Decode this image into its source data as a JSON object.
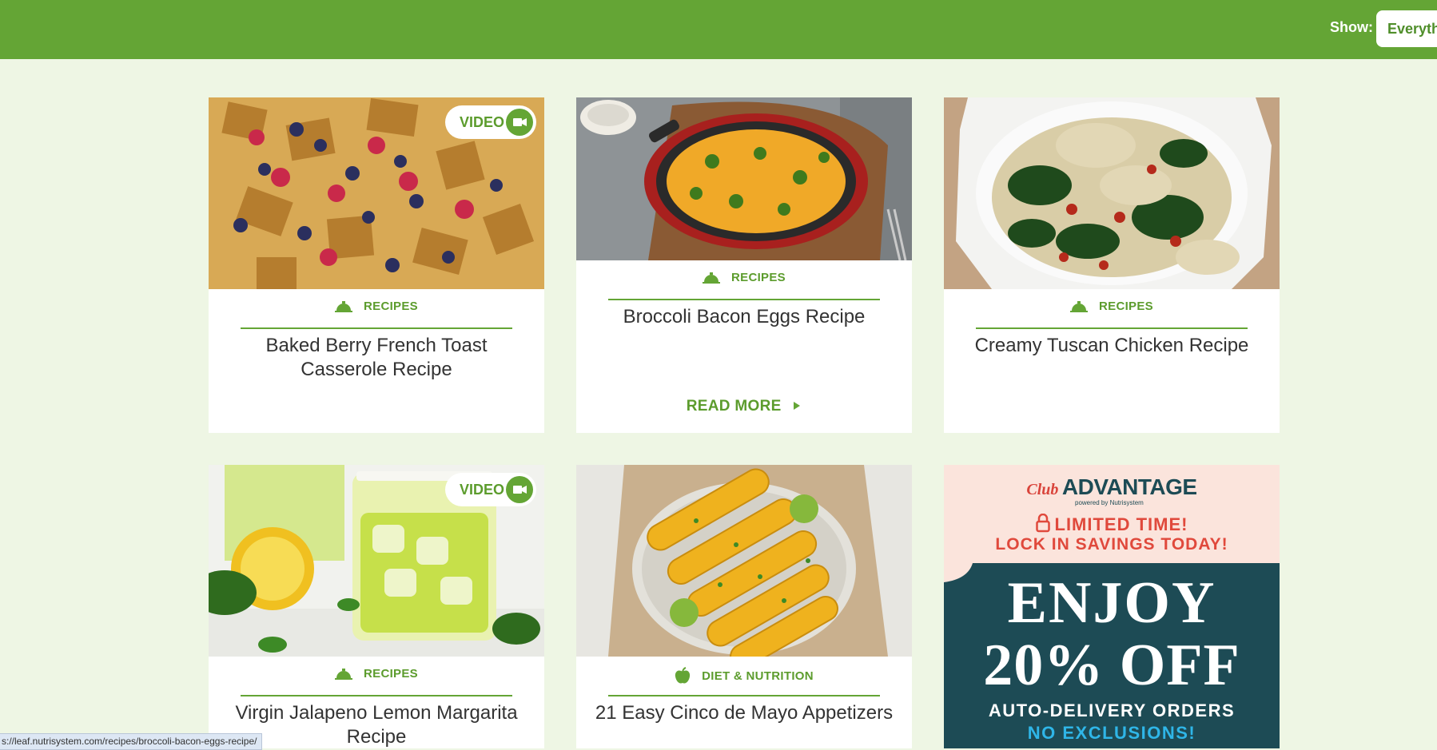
{
  "header": {
    "show_label": "Show:",
    "show_select_value": "Everythi",
    "accent_color": "#64a535"
  },
  "cards": [
    {
      "category": "RECIPES",
      "category_icon": "cloche-icon",
      "title": "Baked Berry French Toast Casserole Recipe",
      "video_label": "VIDEO",
      "image": "berry-french-toast-casserole-photo"
    },
    {
      "category": "RECIPES",
      "category_icon": "cloche-icon",
      "title": "Broccoli Bacon Eggs Recipe",
      "read_more": "READ MORE",
      "image": "broccoli-frittata-skillet-photo"
    },
    {
      "category": "RECIPES",
      "category_icon": "cloche-icon",
      "title": "Creamy Tuscan Chicken Recipe",
      "image": "tuscan-chicken-plate-photo"
    },
    {
      "category": "RECIPES",
      "category_icon": "cloche-icon",
      "title": "Virgin Jalapeno Lemon Margarita Recipe",
      "video_label": "VIDEO",
      "image": "lemon-margarita-glasses-photo"
    },
    {
      "category": "DIET & NUTRITION",
      "category_icon": "apple-icon",
      "title": "21 Easy Cinco de Mayo Appetizers",
      "image": "grilled-corn-platter-photo"
    }
  ],
  "ad": {
    "brand_script": "Club",
    "brand_name": "ADVANTAGE",
    "brand_powered": "powered by Nutrisystem",
    "line1": "LIMITED TIME!",
    "line2": "LOCK IN SAVINGS TODAY!",
    "headline1": "ENJOY",
    "headline2": "20% OFF",
    "sub1": "AUTO-DELIVERY ORDERS",
    "sub2": "NO EXCLUSIONS!"
  },
  "status_bar": {
    "url": "s://leaf.nutrisystem.com/recipes/broccoli-bacon-eggs-recipe/"
  }
}
